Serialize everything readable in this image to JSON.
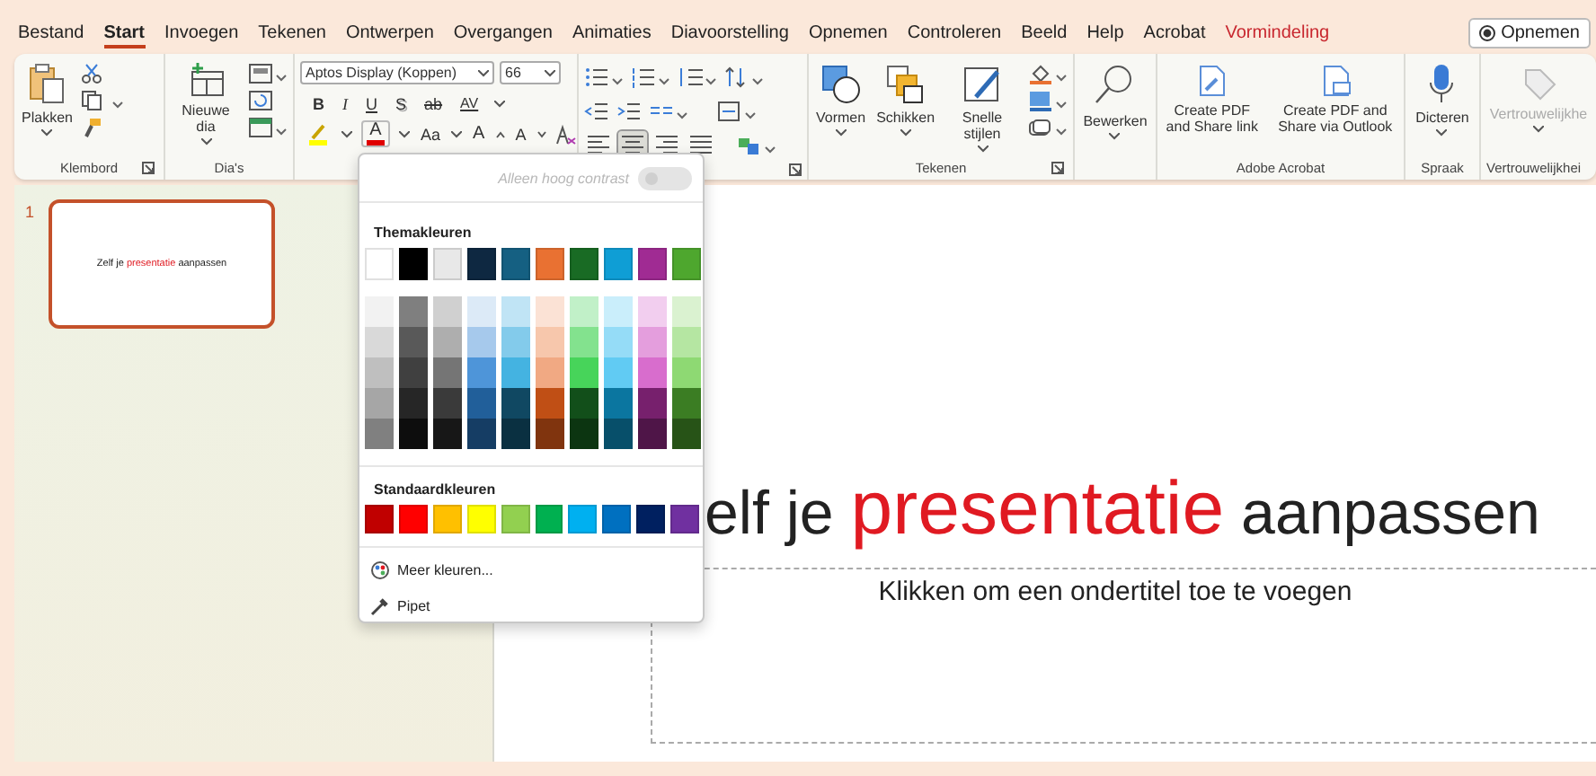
{
  "tabs": [
    {
      "label": "Bestand",
      "selected": false,
      "kind": "normal"
    },
    {
      "label": "Start",
      "selected": true,
      "kind": "normal"
    },
    {
      "label": "Invoegen",
      "selected": false,
      "kind": "normal"
    },
    {
      "label": "Tekenen",
      "selected": false,
      "kind": "normal"
    },
    {
      "label": "Ontwerpen",
      "selected": false,
      "kind": "normal"
    },
    {
      "label": "Overgangen",
      "selected": false,
      "kind": "normal"
    },
    {
      "label": "Animaties",
      "selected": false,
      "kind": "normal"
    },
    {
      "label": "Diavoorstelling",
      "selected": false,
      "kind": "normal"
    },
    {
      "label": "Opnemen",
      "selected": false,
      "kind": "normal"
    },
    {
      "label": "Controleren",
      "selected": false,
      "kind": "normal"
    },
    {
      "label": "Beeld",
      "selected": false,
      "kind": "normal"
    },
    {
      "label": "Help",
      "selected": false,
      "kind": "normal"
    },
    {
      "label": "Acrobat",
      "selected": false,
      "kind": "normal"
    },
    {
      "label": "Vormindeling",
      "selected": false,
      "kind": "contextual"
    }
  ],
  "record_button": {
    "label": "Opnemen"
  },
  "ribbon": {
    "clipboard": {
      "label": "Klembord",
      "paste": "Plakken"
    },
    "slides": {
      "label": "Dia's",
      "new_slide": "Nieuwe dia"
    },
    "font": {
      "name": "Aptos Display (Koppen)",
      "size": "66",
      "format_buttons": [
        "B",
        "I",
        "U",
        "S",
        "ab",
        "AV"
      ],
      "case_button": "Aa",
      "grow_button": "A",
      "shrink_button": "A",
      "font_color_label": "A",
      "font_color": {
        "color": "#e00000"
      },
      "highlight_color": {
        "color": "#ffff00"
      }
    },
    "paragraph": {
      "align": [
        {
          "selected": false
        },
        {
          "selected": true
        },
        {
          "selected": false
        },
        {
          "selected": false
        }
      ]
    },
    "drawing": {
      "label": "Tekenen",
      "buttons": [
        "Vormen",
        "Schikken",
        "Snelle stijlen"
      ]
    },
    "editing": {
      "button": "Bewerken"
    },
    "acrobat": {
      "label": "Adobe Acrobat",
      "buttons": [
        "Create PDF and Share link",
        "Create PDF and Share via Outlook"
      ]
    },
    "voice": {
      "label": "Spraak",
      "button": "Dicteren"
    },
    "sensitivity": {
      "label": "Vertrouwelijkhei",
      "button": "Vertrouwelijkhe",
      "disabled": true
    }
  },
  "color_popup": {
    "contrast_toggle": {
      "label": "Alleen hoog contrast",
      "on": false,
      "disabled": true
    },
    "theme_heading": "Themakleuren",
    "theme_columns": [
      {
        "color": "#ffffff",
        "shades": [
          {
            "color": "#f2f2f2"
          },
          {
            "color": "#d9d9d9"
          },
          {
            "color": "#bfbfbf"
          },
          {
            "color": "#a6a6a6"
          },
          {
            "color": "#808080"
          }
        ]
      },
      {
        "color": "#000000",
        "shades": [
          {
            "color": "#7f7f7f"
          },
          {
            "color": "#595959"
          },
          {
            "color": "#404040"
          },
          {
            "color": "#262626"
          },
          {
            "color": "#0d0d0d"
          }
        ]
      },
      {
        "color": "#e8e8e8",
        "shades": [
          {
            "color": "#d0d0d0"
          },
          {
            "color": "#aeaeae"
          },
          {
            "color": "#757575"
          },
          {
            "color": "#3a3a3a"
          },
          {
            "color": "#171717"
          }
        ]
      },
      {
        "color": "#0e2841",
        "shades": [
          {
            "color": "#dceaf7"
          },
          {
            "color": "#a6c9ec"
          },
          {
            "color": "#4e95d9"
          },
          {
            "color": "#215f9a"
          },
          {
            "color": "#153d64"
          }
        ]
      },
      {
        "color": "#156082",
        "shades": [
          {
            "color": "#c0e4f5"
          },
          {
            "color": "#83cbeb"
          },
          {
            "color": "#44b3e1"
          },
          {
            "color": "#104862"
          },
          {
            "color": "#0a3041"
          }
        ]
      },
      {
        "color": "#e97132",
        "shades": [
          {
            "color": "#fbe2d5"
          },
          {
            "color": "#f7c7ac"
          },
          {
            "color": "#f1a983"
          },
          {
            "color": "#c04f15"
          },
          {
            "color": "#80340e"
          }
        ]
      },
      {
        "color": "#196b24",
        "shades": [
          {
            "color": "#c1f0c8"
          },
          {
            "color": "#83e28e"
          },
          {
            "color": "#47d45a"
          },
          {
            "color": "#124f1a"
          },
          {
            "color": "#0c3511"
          }
        ]
      },
      {
        "color": "#0f9ed5",
        "shades": [
          {
            "color": "#caeefb"
          },
          {
            "color": "#95dcf7"
          },
          {
            "color": "#61cbf3"
          },
          {
            "color": "#0b76a0"
          },
          {
            "color": "#074f6a"
          }
        ]
      },
      {
        "color": "#a02b93",
        "shades": [
          {
            "color": "#f2ceef"
          },
          {
            "color": "#e49edd"
          },
          {
            "color": "#d86dcd"
          },
          {
            "color": "#77206d"
          },
          {
            "color": "#4f1548"
          }
        ]
      },
      {
        "color": "#4ea72e",
        "shades": [
          {
            "color": "#daf2d0"
          },
          {
            "color": "#b5e6a2"
          },
          {
            "color": "#8ed973"
          },
          {
            "color": "#3b7d23"
          },
          {
            "color": "#275317"
          }
        ]
      }
    ],
    "standard_heading": "Standaardkleuren",
    "standard_colors": [
      {
        "color": "#c00000"
      },
      {
        "color": "#ff0000"
      },
      {
        "color": "#ffc000"
      },
      {
        "color": "#ffff00"
      },
      {
        "color": "#92d050"
      },
      {
        "color": "#00b050"
      },
      {
        "color": "#00b0f0"
      },
      {
        "color": "#0070c0"
      },
      {
        "color": "#002060"
      },
      {
        "color": "#7030a0"
      }
    ],
    "more_colors": "Meer kleuren...",
    "eyedropper": "Pipet"
  },
  "slides_pane": {
    "slides": [
      {
        "number": "1",
        "selected": true,
        "title_parts": [
          {
            "text": "Zelf je",
            "emphasis": false
          },
          {
            "text": "presentatie",
            "emphasis": true
          },
          {
            "text": "aanpassen",
            "emphasis": false
          }
        ]
      }
    ]
  },
  "slide": {
    "title_parts": [
      {
        "text": "elf je",
        "emphasis": false
      },
      {
        "text": "presentatie",
        "emphasis": true
      },
      {
        "text": "aanpassen",
        "emphasis": false
      }
    ],
    "subtitle_placeholder": "Klikken om een ondertitel toe te voegen"
  }
}
